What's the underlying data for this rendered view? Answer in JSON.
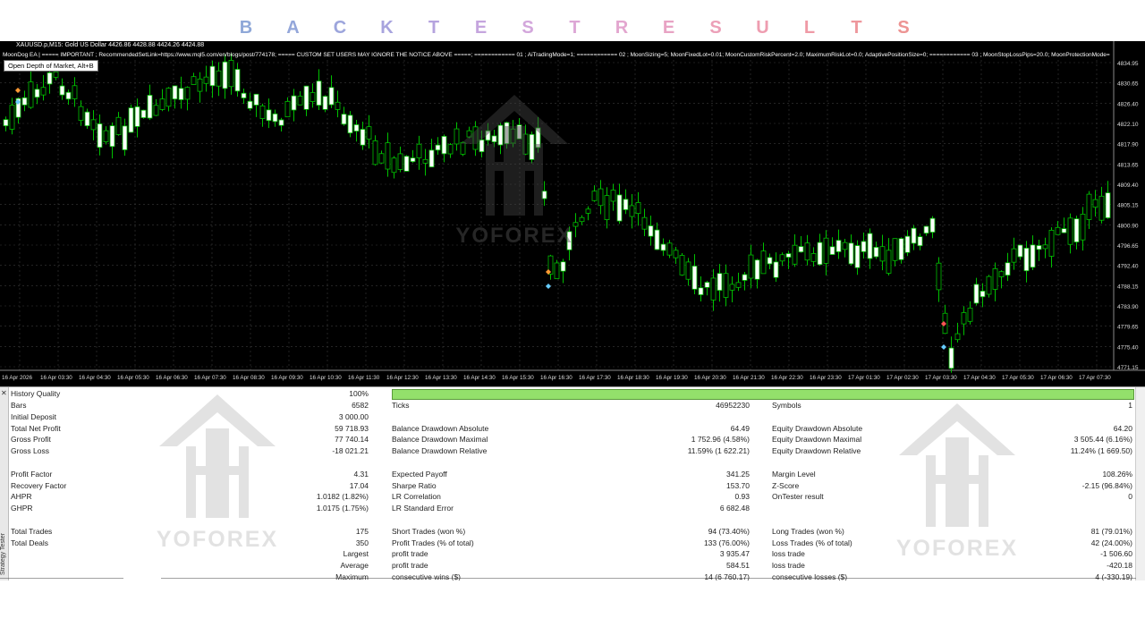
{
  "title_letters": [
    {
      "ch": "B",
      "color": "#8fa8d8"
    },
    {
      "ch": "A",
      "color": "#94a7da"
    },
    {
      "ch": "C",
      "color": "#9ca5dc"
    },
    {
      "ch": "K",
      "color": "#a7a3de"
    },
    {
      "ch": "T",
      "color": "#b5a3de"
    },
    {
      "ch": "E",
      "color": "#c5a5de"
    },
    {
      "ch": "S",
      "color": "#d3a7dc"
    },
    {
      "ch": "T",
      "color": "#dda7d6"
    },
    {
      "ch": "R",
      "color": "#e3a6cf"
    },
    {
      "ch": "E",
      "color": "#e8a3c4"
    },
    {
      "ch": "S",
      "color": "#eca0b8"
    },
    {
      "ch": "U",
      "color": "#ee9db0"
    },
    {
      "ch": "L",
      "color": "#ef9aa6"
    },
    {
      "ch": "T",
      "color": "#ee979c"
    },
    {
      "ch": "S",
      "color": "#ed9493"
    }
  ],
  "chart": {
    "header": "XAUUSD.p,M15:  Gold US Dollar  4426.86 4428.88 4424.26 4424.88",
    "ea_info": "MoonDog EA | ===== IMPORTANT ; RecommendedSetLink=https://www.mql5.com/en/blogs/post/774178; ===== CUSTOM SET USERS MAY IGNORE THE NOTICE ABOVE =====; ============ 01 ; AiTradingMode=1; ============ 02 ; MoonSizing=5; MoonFixedLot=0.01; MoonCustomRiskPercent=2.0; MaximumRiskLot=0.0; AdaptivePositionSize=0; ============ 03 ; MoonStopLossPips=20.0; MoonProtectionMode=",
    "tooltip": "Open Depth of Market, Alt+B",
    "watermark": "YOFOREX",
    "price_labels": [
      "4834.95",
      "4830.65",
      "4826.40",
      "4822.10",
      "4817.90",
      "4813.65",
      "4809.40",
      "4805.15",
      "4800.90",
      "4796.65",
      "4792.40",
      "4788.15",
      "4783.90",
      "4779.65",
      "4775.40",
      "4771.15"
    ],
    "time_labels": [
      "16 Apr 2026",
      "16 Apr 03:30",
      "16 Apr 04:30",
      "16 Apr 05:30",
      "16 Apr 06:30",
      "16 Apr 07:30",
      "16 Apr 08:30",
      "16 Apr 09:30",
      "16 Apr 10:30",
      "16 Apr 11:30",
      "16 Apr 12:30",
      "16 Apr 13:30",
      "16 Apr 14:30",
      "16 Apr 15:30",
      "16 Apr 16:30",
      "16 Apr 17:30",
      "16 Apr 18:30",
      "16 Apr 19:30",
      "16 Apr 20:30",
      "16 Apr 21:30",
      "16 Apr 22:30",
      "16 Apr 23:30",
      "17 Apr 01:30",
      "17 Apr 02:30",
      "17 Apr 03:30",
      "17 Apr 04:30",
      "17 Apr 05:30",
      "17 Apr 06:30",
      "17 Apr 07:30"
    ],
    "colors": {
      "background": "#000000",
      "bull_body": "#ffffff",
      "bear_body": "#000000",
      "wick": "#00c000",
      "grid": "#3a3a3a"
    }
  },
  "tester": {
    "side_label": "Strategy Tester",
    "watermark": "YOFOREX",
    "history_quality": {
      "label": "History Quality",
      "value": "100%",
      "bar_fill": 1.0
    },
    "rows": [
      {
        "c1l": "Bars",
        "c1v": "6582",
        "c2l": "Ticks",
        "c2v": "46952230",
        "c3l": "Symbols",
        "c3v": "1"
      },
      {
        "c1l": "Initial Deposit",
        "c1v": "3 000.00",
        "c2l": "",
        "c2v": "",
        "c3l": "",
        "c3v": ""
      },
      {
        "c1l": "Total Net Profit",
        "c1v": "59 718.93",
        "c2l": "Balance Drawdown Absolute",
        "c2v": "64.49",
        "c3l": "Equity Drawdown Absolute",
        "c3v": "64.20"
      },
      {
        "c1l": "Gross Profit",
        "c1v": "77 740.14",
        "c2l": "Balance Drawdown Maximal",
        "c2v": "1 752.96 (4.58%)",
        "c3l": "Equity Drawdown Maximal",
        "c3v": "3 505.44 (6.16%)"
      },
      {
        "c1l": "Gross Loss",
        "c1v": "-18 021.21",
        "c2l": "Balance Drawdown Relative",
        "c2v": "11.59% (1 622.21)",
        "c3l": "Equity Drawdown Relative",
        "c3v": "11.24% (1 669.50)"
      },
      {
        "c1l": "",
        "c1v": "",
        "c2l": "",
        "c2v": "",
        "c3l": "",
        "c3v": ""
      },
      {
        "c1l": "Profit Factor",
        "c1v": "4.31",
        "c2l": "Expected Payoff",
        "c2v": "341.25",
        "c3l": "Margin Level",
        "c3v": "108.26%"
      },
      {
        "c1l": "Recovery Factor",
        "c1v": "17.04",
        "c2l": "Sharpe Ratio",
        "c2v": "153.70",
        "c3l": "Z-Score",
        "c3v": "-2.15 (96.84%)"
      },
      {
        "c1l": "AHPR",
        "c1v": "1.0182 (1.82%)",
        "c2l": "LR Correlation",
        "c2v": "0.93",
        "c3l": "OnTester result",
        "c3v": "0"
      },
      {
        "c1l": "GHPR",
        "c1v": "1.0175 (1.75%)",
        "c2l": "LR Standard Error",
        "c2v": "6 682.48",
        "c3l": "",
        "c3v": ""
      },
      {
        "c1l": "",
        "c1v": "",
        "c2l": "",
        "c2v": "",
        "c3l": "",
        "c3v": ""
      },
      {
        "c1l": "Total Trades",
        "c1v": "175",
        "c2l": "Short Trades (won %)",
        "c2v": "94 (73.40%)",
        "c3l": "Long Trades (won %)",
        "c3v": "81 (79.01%)"
      },
      {
        "c1l": "Total Deals",
        "c1v": "350",
        "c2l": "Profit Trades (% of total)",
        "c2v": "133 (76.00%)",
        "c3l": "Loss Trades (% of total)",
        "c3v": "42 (24.00%)"
      },
      {
        "c1l": "",
        "c1v": "Largest",
        "c2l": "profit trade",
        "c2v": "3 935.47",
        "c3l": "loss trade",
        "c3v": "-1 506.60"
      },
      {
        "c1l": "",
        "c1v": "Average",
        "c2l": "profit trade",
        "c2v": "584.51",
        "c3l": "loss trade",
        "c3v": "-420.18"
      },
      {
        "c1l": "",
        "c1v": "Maximum",
        "c2l": "consecutive wins ($)",
        "c2v": "14 (6 760.17)",
        "c3l": "consecutive losses ($)",
        "c3v": "4 (-330.19)"
      }
    ]
  }
}
